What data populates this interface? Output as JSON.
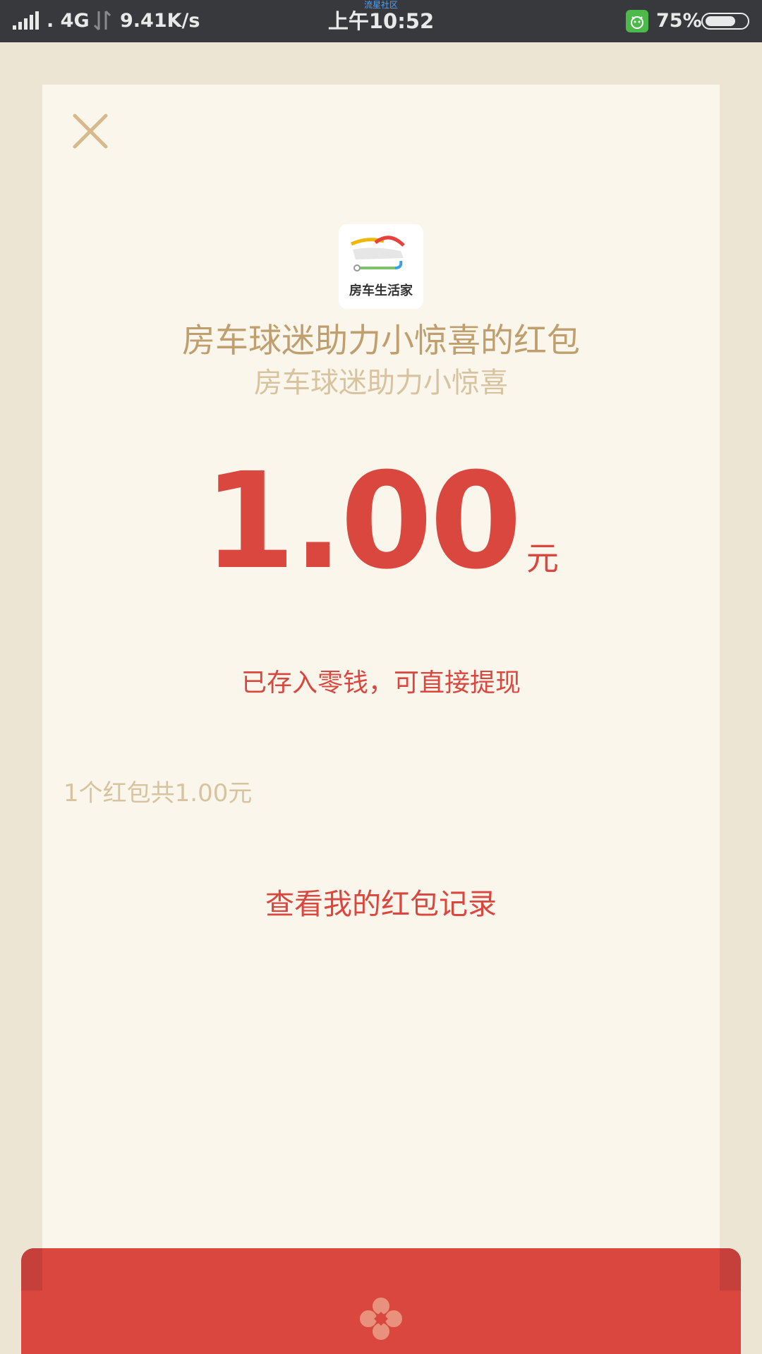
{
  "status_bar": {
    "network": ". 4G",
    "speed": "9.41K/s",
    "carrier_label": "流星社区",
    "time": "上午10:52",
    "battery_percent": "75%",
    "battery_level": 0.75
  },
  "card": {
    "logo_text": "房车生活家",
    "title": "房车球迷助力小惊喜的红包",
    "subtitle": "房车球迷助力小惊喜",
    "amount": "1.00",
    "unit": "元",
    "note": "已存入零钱，可直接提现",
    "summary": "1个红包共1.00元",
    "records_link": "查看我的红包记录"
  },
  "colors": {
    "accent_red": "#d9473f",
    "gold": "#c09f6f",
    "light_gold": "#d8c39f",
    "card_bg": "#faf6ec",
    "page_bg": "#ede5d3"
  },
  "icons": [
    "signal-icon",
    "data-arrows-icon",
    "app-notification-icon",
    "battery-icon",
    "close-icon",
    "flower-icon"
  ]
}
